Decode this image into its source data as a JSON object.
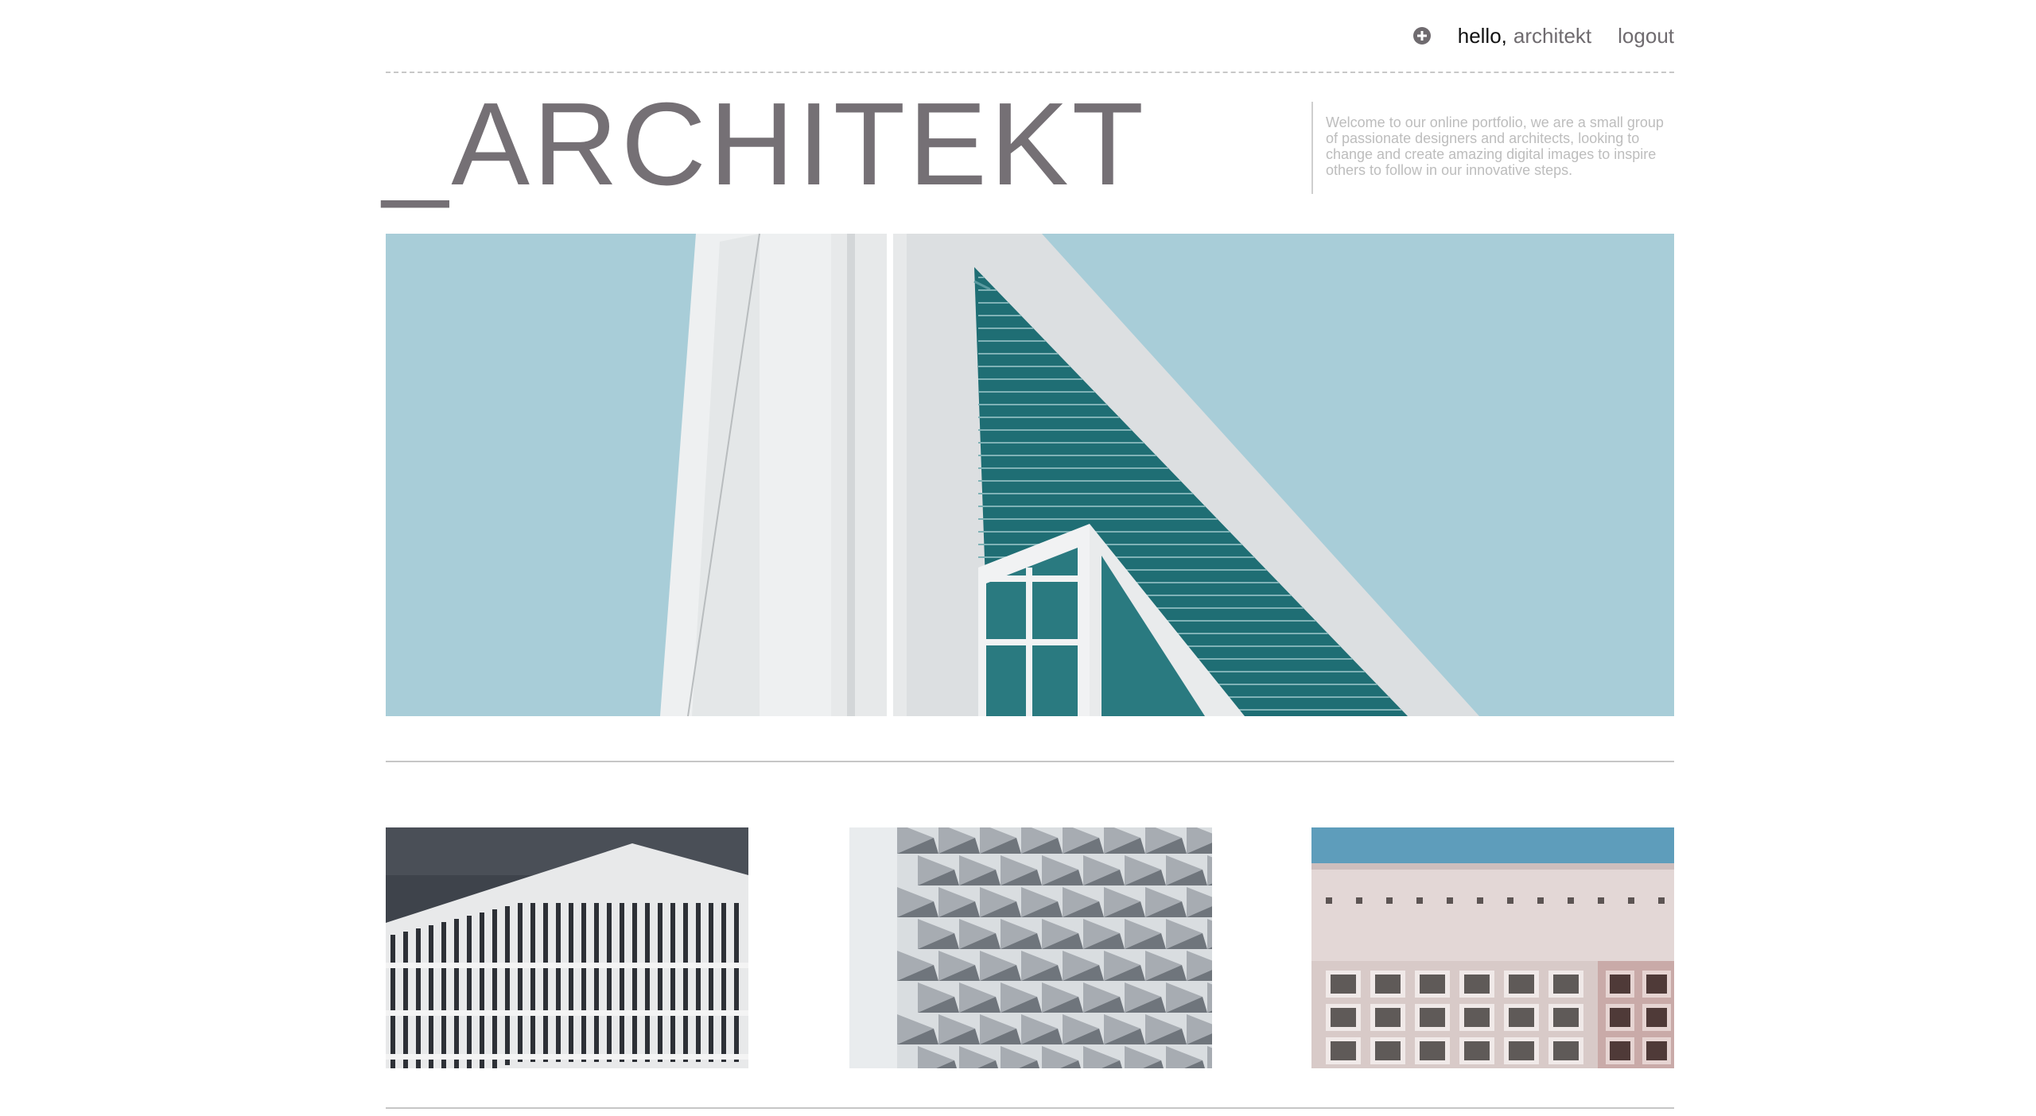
{
  "nav": {
    "greeting": "hello,",
    "username": "architekt",
    "logout_label": "logout",
    "add_icon": "plus-circle-icon"
  },
  "brand": {
    "title": "_ARCHITEKT"
  },
  "intro": {
    "text": "Welcome to our online portfolio, we are a small group of passionate designers and architects, looking to change and create amazing digital images to inspire others to follow in our innovative steps."
  },
  "colors": {
    "brand_text": "#757075",
    "sky": "#a8cdd8",
    "glass": "#1f6e74",
    "muted_text": "#bdbdbd"
  },
  "gallery": {
    "hero": "white tower with teal glass facade against blue sky",
    "thumbnails": [
      "white grid building under dark sky",
      "silver pyramid-patterned facade",
      "pink stone facade with window grid"
    ]
  }
}
